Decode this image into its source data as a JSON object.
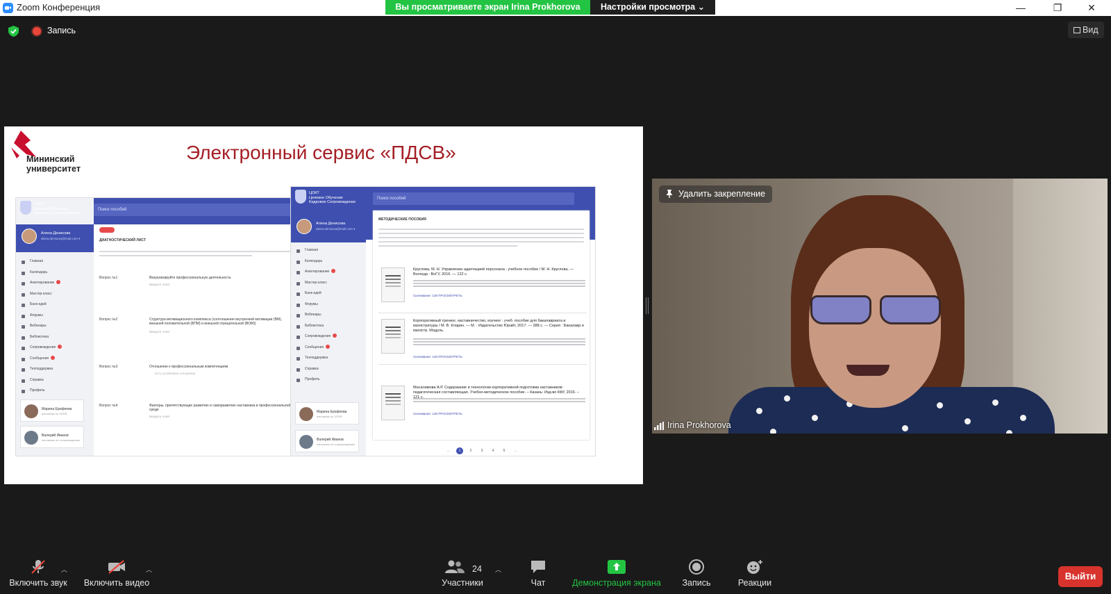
{
  "window": {
    "title": "Zoom Конференция",
    "share_banner": "Вы просматриваете экран Irina Prokhorova",
    "view_options": "Настройки просмотра ⌄",
    "minimize": "—",
    "restore": "❐",
    "close": "✕"
  },
  "status": {
    "recording": "Запись",
    "view": "Вид"
  },
  "slide": {
    "logo_line1": "Мининский",
    "logo_line2": "университет",
    "title": "Электронный сервис «ПДСВ»",
    "left_screen": {
      "search": "Поиск пособий",
      "org": "ЦОКТ",
      "org_sub1": "Целевое Обучение",
      "org_sub2": "Кадровое Сопровождение",
      "user": "Алена Денисова",
      "user_email": "alena.denisova@mail.com ▾",
      "heading": "ДИАГНОСТИЧЕСКИЙ ЛИСТ",
      "menu": [
        "Главная",
        "Календарь",
        "Анкетирование",
        "Мастер-класс",
        "Банк идей",
        "Форумы",
        "Вебинары",
        "Библиотека",
        "Сопровождение",
        "Сообщения",
        "Техподдержка",
        "Справка",
        "Профиль"
      ],
      "questions": [
        {
          "label": "Вопрос №1",
          "text": "Визуализируйте профессиональную деятельность",
          "hint": "Введите ответ"
        },
        {
          "label": "Вопрос №2",
          "text": "Структура мотивационного комплекса (соотношение внутренней мотивации (ВМ), внешней положительной (ВПМ) и внешней отрицательной (ВОМ))",
          "hint": "Введите ответ"
        },
        {
          "label": "Вопрос №3",
          "text": "Отношение к профессиональным компетенциям",
          "hint": "есть устойчивое отношение"
        },
        {
          "label": "Вопрос №4",
          "text": "Факторы, препятствующие развитию и саморазвитию наставника в профессиональной среде",
          "hint": "Введите ответ"
        }
      ],
      "people": [
        {
          "name": "Марина Ерофеева",
          "role": "наставник по ЗППЯ"
        },
        {
          "name": "Валерий Иванов",
          "role": "наставник по сопровождению"
        }
      ]
    },
    "right_screen": {
      "search": "Поиск пособий",
      "org": "ЦОКТ",
      "org_sub1": "Целевое Обучение",
      "org_sub2": "Кадровое Сопровождение",
      "user": "Алена Денисова",
      "user_email": "alena.denisova@mail.com ▾",
      "heading": "МЕТОДИЧЕСКИЕ ПОСОБИЯ",
      "menu": [
        "Главная",
        "Календарь",
        "Анкетирование",
        "Мастер-класс",
        "Банк идей",
        "Форумы",
        "Вебинары",
        "Библиотека",
        "Сопровождение",
        "Сообщения",
        "Техподдержка",
        "Справка",
        "Профиль"
      ],
      "docs": [
        {
          "title": "Круглова, М. Н. Управление адаптацией персонала : учебное пособие / М. Н. Круглова. — Вологда : ВоГУ, 2016. — 122 с.",
          "link": "Скачивание: 138    ПРОСМОТРЕТЬ"
        },
        {
          "title": "Корпоративный тренинг, наставничество, коучинг : учеб. пособие для бакалавриата и магистратуры / М. В. Кларин. — М. : Издательство Юрайт, 2017. — 288 с. — Серия : Бакалавр и магистр. Модуль.",
          "link": "Скачивание: 138    ПРОСМОТРЕТЬ"
        },
        {
          "title": "Масалимова А.Р. Содержание и технологии корпоративной подготовки наставников: педагогическая составляющая. Учебно-методическое пособие. – Казань: Изд-во КФУ, 2016. – 121 с.",
          "link": "Скачивание: 138    ПРОСМОТРЕТЬ"
        }
      ],
      "pager": [
        "←",
        "1",
        "2",
        "3",
        "4",
        "5",
        "→"
      ],
      "people": [
        {
          "name": "Марина Ерофеева",
          "role": "наставник по ЗППЯ"
        },
        {
          "name": "Валерий Иванов",
          "role": "наставник по сопровождению"
        }
      ]
    }
  },
  "video": {
    "unpin": "Удалить закрепление",
    "participant_name": "Irina Prokhorova"
  },
  "toolbar": {
    "audio": "Включить звук",
    "video": "Включить видео",
    "participants": "Участники",
    "participants_count": "24",
    "chat": "Чат",
    "share": "Демонстрация экрана",
    "record": "Запись",
    "reactions": "Реакции",
    "leave": "Выйти"
  },
  "colors": {
    "share_green": "#23c443",
    "leave_red": "#d8332d",
    "slide_title_red": "#a41e24",
    "mock_blue": "#3e4fb0"
  }
}
